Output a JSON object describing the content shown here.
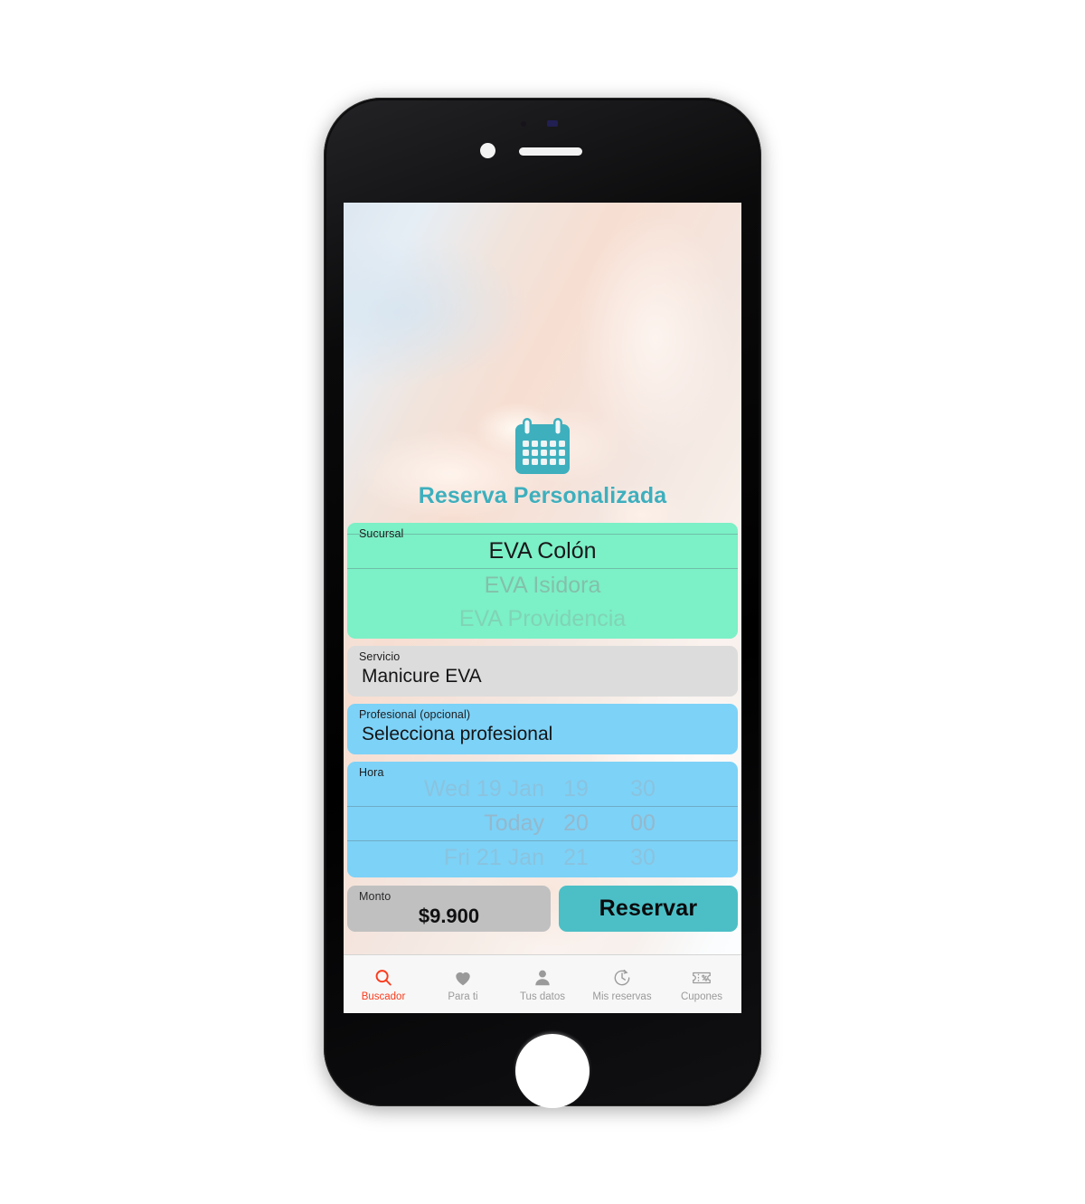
{
  "device": {
    "type": "smartphone-mockup",
    "home_button": "home-button",
    "camera": "front-camera",
    "speaker": "earpiece-speaker"
  },
  "app": {
    "title": "Reserva Personalizada",
    "title_color": "#3eafbd",
    "icon": "calendar-icon",
    "background": "blurred-manicured-hands-photo"
  },
  "form": {
    "sucursal": {
      "label": "Sucursal",
      "bg_color": "#7cf0c6",
      "options": [
        "EVA Colón",
        "EVA Isidora",
        "EVA Providencia"
      ],
      "selected": "EVA Colón",
      "below_1": "EVA Isidora",
      "below_2": "EVA Providencia"
    },
    "servicio": {
      "label": "Servicio",
      "bg_color": "#dcdcdc",
      "value": "Manicure EVA"
    },
    "profesional": {
      "label": "Profesional (opcional)",
      "bg_color": "#7dd2f7",
      "value": "Selecciona profesional"
    },
    "hora": {
      "label": "Hora",
      "bg_color": "#7dd2f7",
      "rows": [
        {
          "date": "Wed 19 Jan",
          "hour": "19",
          "minute": "30"
        },
        {
          "date": "Today",
          "hour": "20",
          "minute": "00"
        },
        {
          "date": "Fri 21 Jan",
          "hour": "21",
          "minute": "30"
        }
      ],
      "selected_index": 1
    },
    "monto": {
      "label": "Monto",
      "bg_color": "#c0c0c0",
      "value": "$9.900"
    },
    "reserve_button": {
      "label": "Reservar",
      "bg_color": "#4cbfc6"
    }
  },
  "tab_bar": {
    "active_color": "#fa3c1e",
    "inactive_color": "#9a9a9a",
    "items": [
      {
        "label": "Buscador",
        "icon": "search-icon",
        "active": true
      },
      {
        "label": "Para ti",
        "icon": "heart-icon",
        "active": false
      },
      {
        "label": "Tus datos",
        "icon": "person-icon",
        "active": false
      },
      {
        "label": "Mis reservas",
        "icon": "clock-history-icon",
        "active": false
      },
      {
        "label": "Cupones",
        "icon": "ticket-percent-icon",
        "active": false
      }
    ]
  }
}
